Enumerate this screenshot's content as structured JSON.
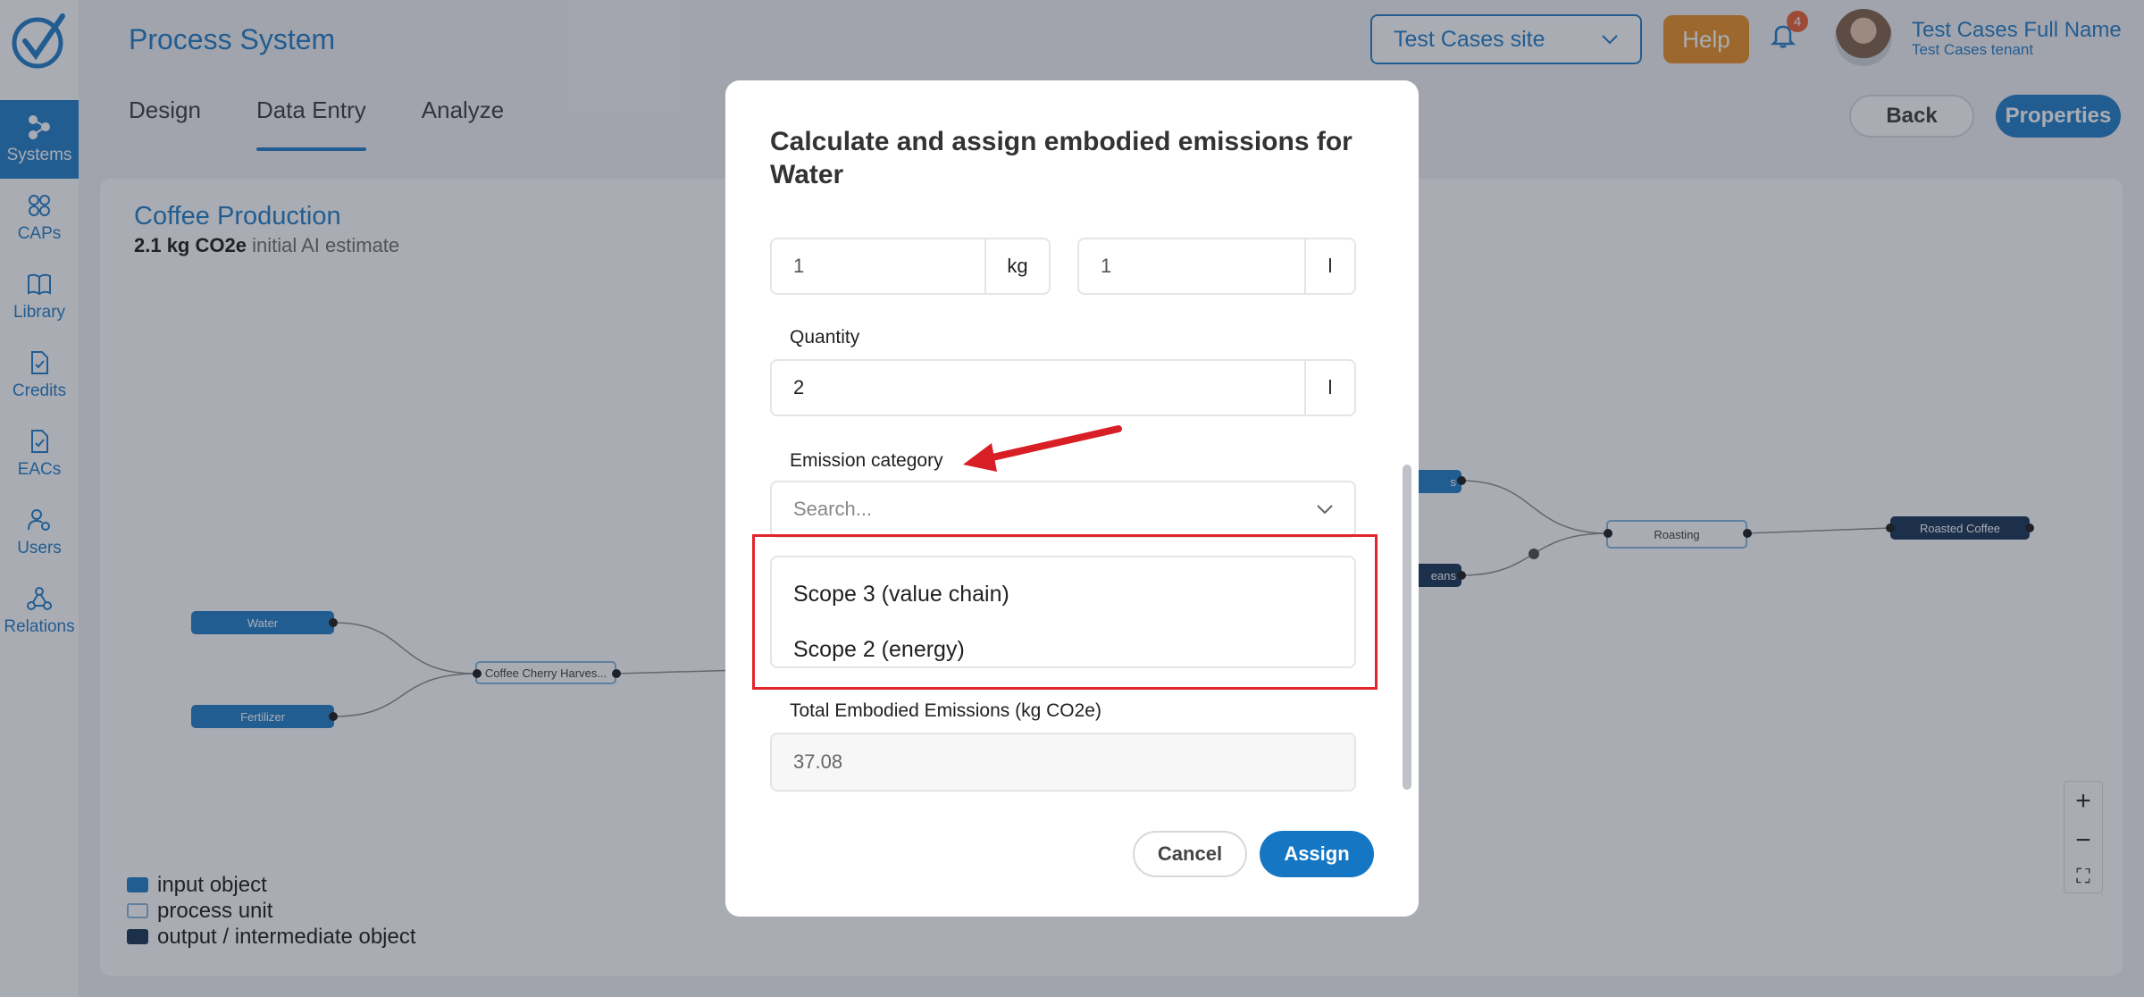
{
  "app": {
    "title": "Process System"
  },
  "sidebar": {
    "items": [
      {
        "label": "Systems",
        "icon": "systems-icon",
        "active": true
      },
      {
        "label": "CAPs",
        "icon": "caps-icon"
      },
      {
        "label": "Library",
        "icon": "book-icon"
      },
      {
        "label": "Credits",
        "icon": "document-check-icon"
      },
      {
        "label": "EACs",
        "icon": "document-check-icon"
      },
      {
        "label": "Users",
        "icon": "users-gear-icon"
      },
      {
        "label": "Relations",
        "icon": "relations-icon"
      }
    ]
  },
  "header": {
    "site_select": "Test Cases site",
    "help_label": "Help",
    "notification_count": "4",
    "user_name": "Test Cases Full Name",
    "user_tenant": "Test Cases tenant"
  },
  "tabs": [
    {
      "label": "Design"
    },
    {
      "label": "Data Entry",
      "active": true
    },
    {
      "label": "Analyze"
    }
  ],
  "actions": {
    "back_label": "Back",
    "properties_label": "Properties"
  },
  "project": {
    "title": "Coffee Production",
    "estimate_value": "2.1 kg CO2e",
    "estimate_note": "initial AI estimate"
  },
  "nodes": {
    "water": "Water",
    "fertilizer": "Fertilizer",
    "harvest": "Coffee Cherry Harves...",
    "partial_top": "s",
    "partial_bottom": "eans",
    "roasting": "Roasting",
    "roasted": "Roasted Coffee"
  },
  "legend": [
    {
      "label": "input object",
      "color": "#1577c4"
    },
    {
      "label": "process unit",
      "color": "#ffffff"
    },
    {
      "label": "output / intermediate object",
      "color": "#0c2a4d"
    }
  ],
  "zoom": {
    "in": "+",
    "out": "−",
    "fit": "⛶"
  },
  "modal": {
    "title": "Calculate and assign embodied emissions for Water",
    "ratio_left_value": "1",
    "ratio_left_unit": "kg",
    "ratio_right_value": "1",
    "ratio_right_unit": "l",
    "quantity_label": "Quantity",
    "quantity_value": "2",
    "quantity_unit": "l",
    "category_label": "Emission category",
    "category_placeholder": "Search...",
    "category_options": [
      "Scope 3 (value chain)",
      "Scope 2 (energy)"
    ],
    "total_label": "Total Embodied Emissions (kg CO2e)",
    "total_value": "37.08",
    "cancel_label": "Cancel",
    "assign_label": "Assign"
  },
  "colors": {
    "primary": "#1577c4",
    "help": "#e78b1a",
    "dark_node": "#0c2a4d",
    "annotation": "#e0262c"
  }
}
